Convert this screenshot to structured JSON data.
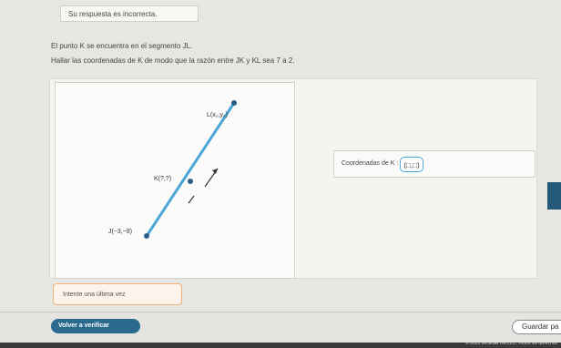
{
  "feedback": {
    "text": "Su respuesta es incorrecta."
  },
  "problem": {
    "line1": "El punto K se encuentra en el segmento JL.",
    "line2": "Hallar las coordenadas de K de modo que la razón entre JK y KL sea 7 a 2."
  },
  "figure": {
    "point_l_label": "L(x₂,y₂)",
    "point_k_label": "K(?,?)",
    "point_j_label": "J(−3,−8)"
  },
  "answer": {
    "label": "Coordenadas de K :",
    "value": "(□,□)"
  },
  "try_again": {
    "text": "Intente una última vez"
  },
  "footer": {
    "back_label": "Volver a verificar",
    "save_label": "Guardar pa"
  },
  "copyright": "© 2025 McGraw Hill LLC. Todos los derechos"
}
